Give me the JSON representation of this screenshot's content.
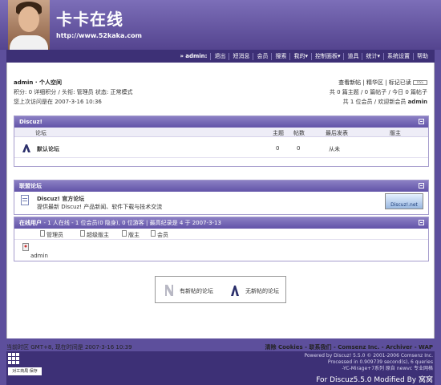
{
  "header": {
    "site_title": "卡卡在线",
    "site_url": "http://www.52kaka.com"
  },
  "nav": {
    "user_prefix": "»",
    "username": "admin:",
    "items": [
      "退出",
      "短消息",
      "会员",
      "搜索",
      "我的▾",
      "控制面板▾",
      "道具",
      "统计▾",
      "系统设置",
      "帮助"
    ]
  },
  "user_info": {
    "title": "admin · 个人空间",
    "stats": "积分: 0 详细积分 / 头衔: 管理员 状态: 正常模式",
    "last_visit": "您上次访问是在 2007-3-16 10:36"
  },
  "top_right": {
    "links": "查看新帖 | 精华区 | 标记已读",
    "rss": "RSS",
    "today": "共 0 篇主题 / 0 篇帖子 / 今日 0 篇帖子",
    "members": "共 1 位会员 / 欢迎新会员",
    "new_member": "admin"
  },
  "forum_box": {
    "title": "Discuz!",
    "columns": [
      "论坛",
      "主题",
      "帖数",
      "最后发表",
      "版主"
    ],
    "rows": [
      {
        "name": "默认论坛",
        "topics": "0",
        "posts": "0",
        "last": "从未",
        "mods": ""
      }
    ]
  },
  "alliance_box": {
    "title": "联盟论坛",
    "name": "Discuz! 官方论坛",
    "desc": "提供最新 Discuz! 产品新闻、软件下载与技术交流",
    "logo_text": "Discuz!.net"
  },
  "online_box": {
    "title": "在线用户",
    "summary": "- 1 人在线 - 1 位会员(0 隐身), 0 位游客 | 最高纪录是 4 于 2007-3-13",
    "legend": [
      "管理员",
      "超级版主",
      "版主",
      "会员"
    ],
    "users": [
      "admin"
    ]
  },
  "legend_box": {
    "new_posts": "有新帖的论坛",
    "no_new": "无新帖的论坛"
  },
  "footer": {
    "time": "当前时区 GMT+8, 现在时间是 2007-3-16 10:39",
    "links": "清除 Cookies - 联系我们 - Comsenz Inc. - Archiver - WAP",
    "powered_line1": "Powered by Discuz! 5.5.0 © 2001-2006 Comsenz Inc.",
    "powered_line2": "Processed in 0.909739 second(s), 6 queries",
    "powered_line3": "-YC-Mirage+7系列 原自 newvc 专业网格",
    "modded": "For Discuz5.5.0 Modified By 窝窝",
    "badge": "对工商局 保存"
  },
  "colors": {
    "bg": "#5d4f9c",
    "nav": "#3d3076",
    "accent": "#6253a8"
  }
}
